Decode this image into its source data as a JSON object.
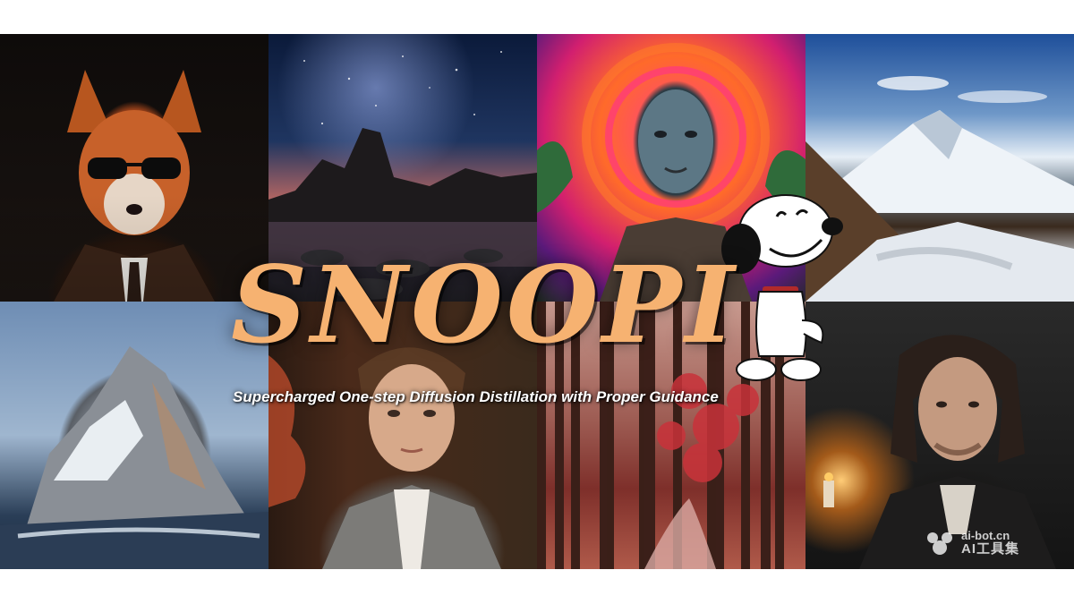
{
  "title": "SNOOPI",
  "subtitle": "Supercharged One-step Diffusion Distillation with Proper Guidance",
  "watermark": {
    "url": "ai-bot.cn",
    "brand": "AI工具集"
  },
  "images": [
    {
      "name": "fox-in-suit-image"
    },
    {
      "name": "starry-lake-image"
    },
    {
      "name": "psychedelic-portrait-image"
    },
    {
      "name": "snowy-mountain-trail-image"
    },
    {
      "name": "snowy-rock-island-image"
    },
    {
      "name": "young-man-portrait-image"
    },
    {
      "name": "red-forest-path-image"
    },
    {
      "name": "long-haired-man-portrait-image"
    }
  ],
  "colors": {
    "title": "#f6b271",
    "subtitle": "#ffffff",
    "background": "#ffffff"
  }
}
